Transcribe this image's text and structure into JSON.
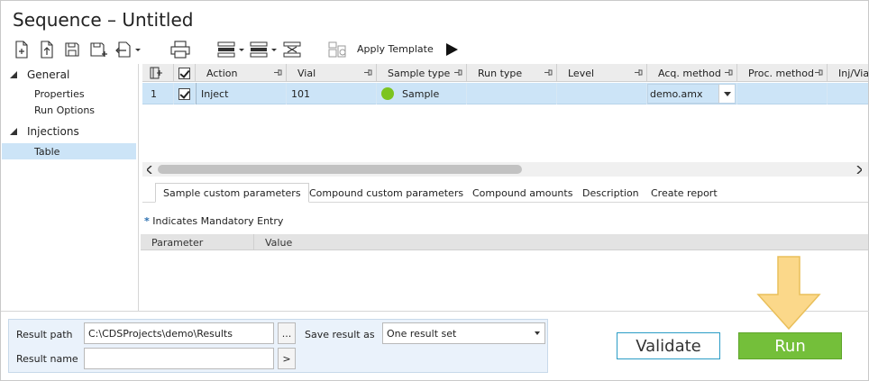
{
  "window": {
    "title": "Sequence – Untitled"
  },
  "toolbar": {
    "apply_template_label": "Apply Template",
    "icons": [
      "new-icon",
      "open-icon",
      "save-icon",
      "save-as-icon",
      "import-icon",
      "print-icon",
      "insert-rows-icon",
      "move-rows-icon",
      "delete-rows-icon",
      "template-icon",
      "run-icon"
    ]
  },
  "sidebar": {
    "groups": [
      {
        "label": "General",
        "items": [
          {
            "label": "Properties"
          },
          {
            "label": "Run Options"
          }
        ]
      },
      {
        "label": "Injections",
        "items": [
          {
            "label": "Table"
          }
        ]
      }
    ]
  },
  "grid": {
    "columns": [
      "Action",
      "Vial",
      "Sample type",
      "Run type",
      "Level",
      "Acq. method",
      "Proc. method",
      "Inj/Via"
    ],
    "rows": [
      {
        "index": "1",
        "checked": true,
        "action": "Inject",
        "vial": "101",
        "sample_type": "Sample",
        "run_type": "",
        "level": "",
        "acq_method": "demo.amx",
        "proc_method": ""
      }
    ]
  },
  "tabs": [
    "Sample custom parameters",
    "Compound custom parameters",
    "Compound amounts",
    "Description",
    "Create report"
  ],
  "params": {
    "mandatory_star": "*",
    "mandatory_text": "Indicates Mandatory Entry",
    "columns": [
      "Parameter",
      "Value"
    ]
  },
  "result": {
    "path_label": "Result path",
    "path_value": "C:\\CDSProjects\\demo\\Results",
    "browse_label": "...",
    "name_label": "Result name",
    "name_value": "",
    "name_button": ">",
    "save_as_label": "Save result as",
    "save_as_value": "One result set"
  },
  "actions": {
    "validate_label": "Validate",
    "run_label": "Run"
  },
  "colors": {
    "selection": "#cce4f7",
    "run": "#74bf3a",
    "validate_border": "#2a9cc6",
    "annotation_arrow": "#fbd88a",
    "sample_dot": "#7cc420"
  }
}
